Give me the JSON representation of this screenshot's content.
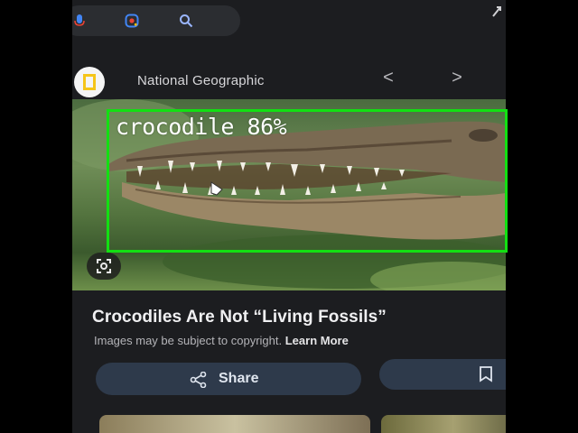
{
  "toolbar": {
    "icons": [
      "mic-icon",
      "google-lens-icon",
      "search-icon"
    ],
    "corner_icon": "share-up-icon"
  },
  "source": {
    "name": "National Geographic",
    "logo_icon": "natgeo-frame-icon",
    "prev_icon": "chevron-left-icon",
    "prev_label": "<",
    "next_icon": "chevron-right-icon",
    "next_label": ">"
  },
  "image": {
    "subject": "crocodile-jaws-photo",
    "lens_button_icon": "lens-crop-icon"
  },
  "detection": {
    "label": "crocodile 86%",
    "box_color": "#12e012"
  },
  "result": {
    "title": "Crocodiles Are Not “Living Fossils”",
    "caption": "Images may be subject to copyright.",
    "learn_more": "Learn More"
  },
  "actions": {
    "share_label": "Share",
    "share_icon": "share-icon",
    "save_icon": "bookmark-icon"
  },
  "colors": {
    "background": "#1c1d20",
    "button": "#2e3a4b",
    "text": "#f0f0f2"
  }
}
